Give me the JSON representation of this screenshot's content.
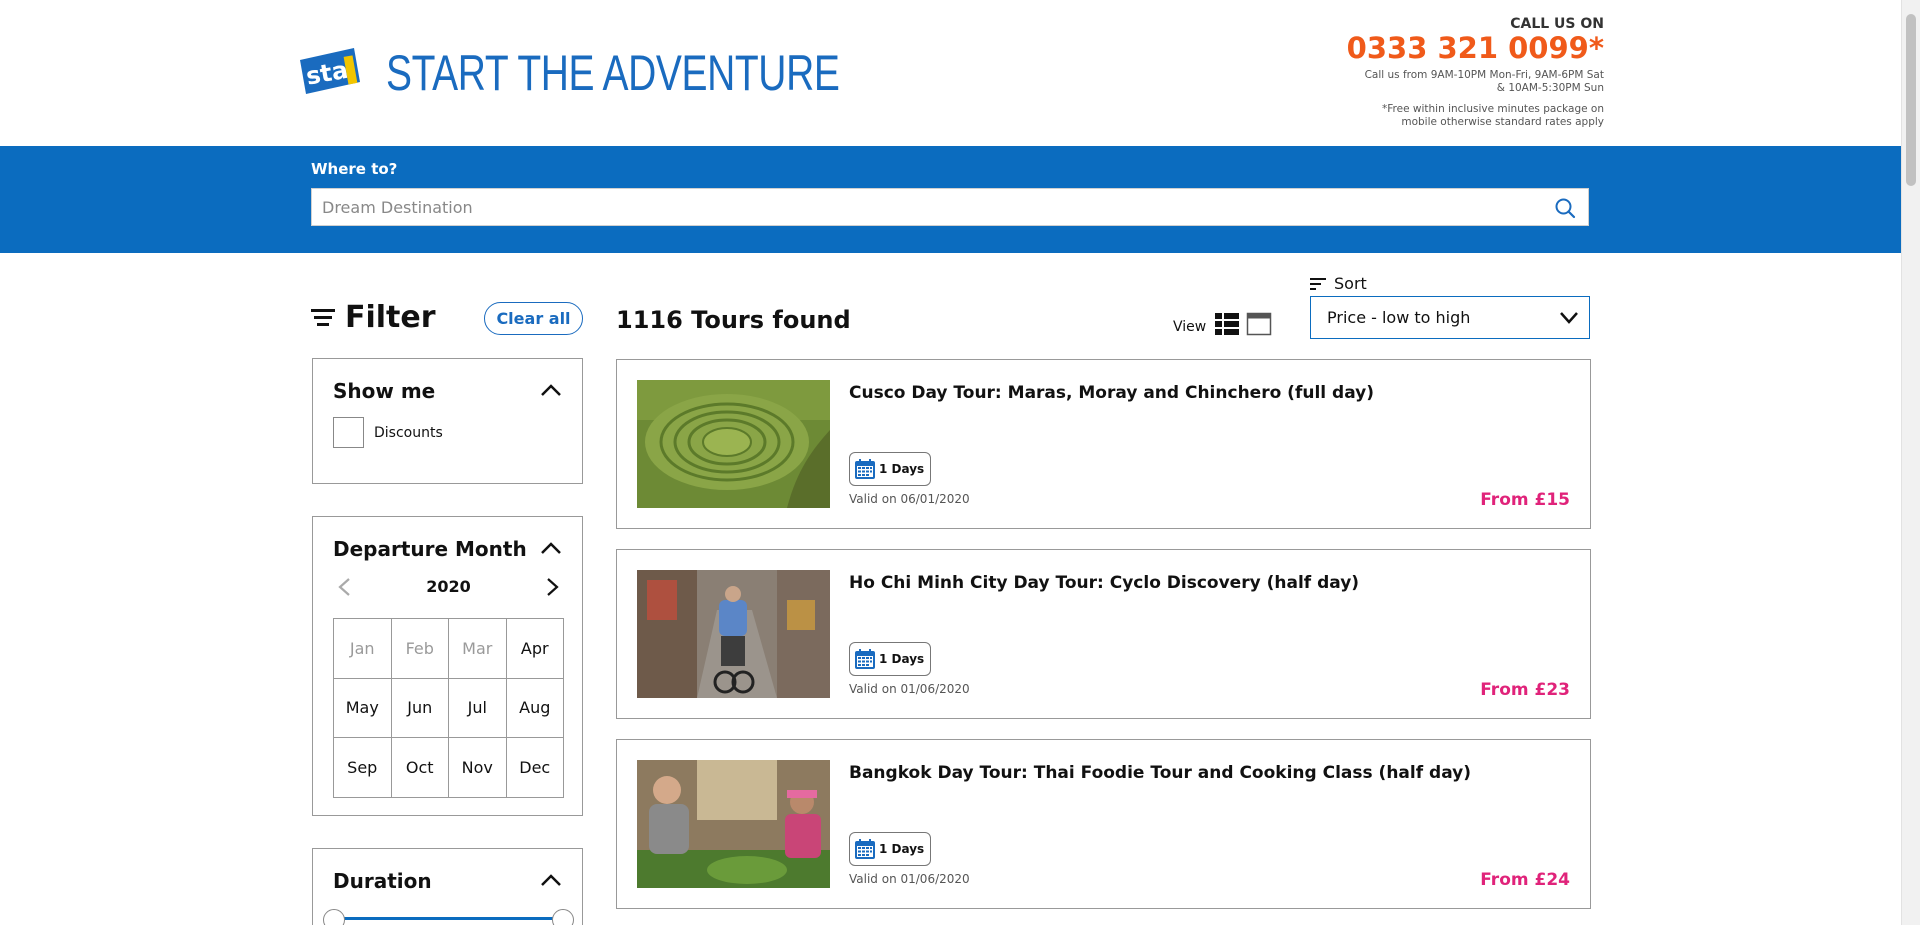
{
  "header": {
    "tagline": "START THE ADVENTURE",
    "call_label": "CALL US ON",
    "phone": "0333 321 0099*",
    "hours_line1": "Call us from 9AM-10PM Mon-Fri, 9AM-6PM Sat",
    "hours_line2": "& 10AM-5:30PM Sun",
    "note_line1": "*Free within inclusive minutes package on",
    "note_line2": "mobile otherwise standard rates apply",
    "brand_color": "#1a6bbf",
    "phone_color": "#f05a1a"
  },
  "search": {
    "label": "Where to?",
    "placeholder": "Dream Destination",
    "value": ""
  },
  "filter": {
    "title": "Filter",
    "clear_label": "Clear all",
    "show_me": {
      "title": "Show me",
      "options": [
        {
          "label": "Discounts",
          "checked": false
        }
      ]
    },
    "departure": {
      "title": "Departure Month",
      "year": "2020",
      "months": [
        {
          "label": "Jan",
          "enabled": false
        },
        {
          "label": "Feb",
          "enabled": false
        },
        {
          "label": "Mar",
          "enabled": false
        },
        {
          "label": "Apr",
          "enabled": true
        },
        {
          "label": "May",
          "enabled": true
        },
        {
          "label": "Jun",
          "enabled": true
        },
        {
          "label": "Jul",
          "enabled": true
        },
        {
          "label": "Aug",
          "enabled": true
        },
        {
          "label": "Sep",
          "enabled": true
        },
        {
          "label": "Oct",
          "enabled": true
        },
        {
          "label": "Nov",
          "enabled": true
        },
        {
          "label": "Dec",
          "enabled": true
        }
      ]
    },
    "duration": {
      "title": "Duration"
    }
  },
  "results": {
    "count_text": "1116 Tours found",
    "view_label": "View",
    "sort_label": "Sort",
    "sort_value": "Price - low to high",
    "price_color": "#e0237a",
    "tours": [
      {
        "title": "Cusco Day Tour: Maras, Moray and Chinchero (full day)",
        "duration": "1 Days",
        "valid": "Valid on 06/01/2020",
        "price": "From £15"
      },
      {
        "title": "Ho Chi Minh City Day Tour: Cyclo Discovery (half day)",
        "duration": "1 Days",
        "valid": "Valid on 01/06/2020",
        "price": "From £23"
      },
      {
        "title": "Bangkok Day Tour: Thai Foodie Tour and Cooking Class (half day)",
        "duration": "1 Days",
        "valid": "Valid on 01/06/2020",
        "price": "From £24"
      }
    ]
  }
}
